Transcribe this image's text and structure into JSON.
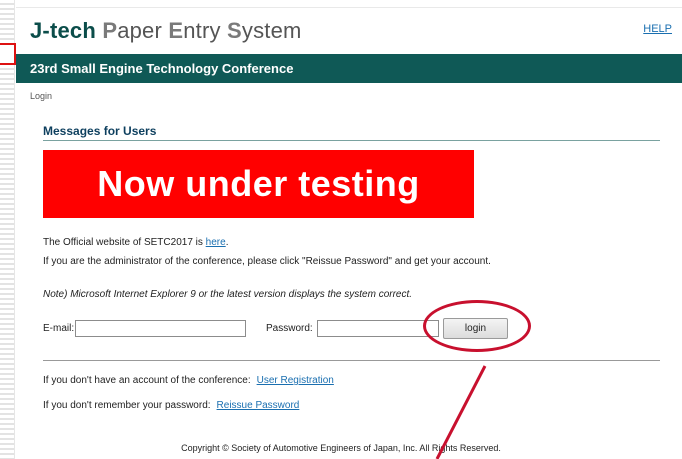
{
  "app": {
    "logo": {
      "part1": "J-tech",
      "p_cap": "P",
      "p_rest": "aper",
      "e_cap": "E",
      "e_rest": "ntry",
      "s_cap": "S",
      "s_rest": "ystem"
    },
    "help_label": "HELP"
  },
  "banner": {
    "title": "23rd Small Engine Technology Conference"
  },
  "breadcrumb": {
    "current": "Login"
  },
  "messages": {
    "heading": "Messages for Users",
    "testing_notice": "Now under testing",
    "official_prefix": "The Official website of SETC2017 is ",
    "official_link": "here",
    "official_suffix": ".",
    "admin_text": "If you are the administrator of the conference, please click \"Reissue Password\" and get your account.",
    "browser_note": "Note) Microsoft Internet Explorer 9 or the latest version displays the system correct."
  },
  "login_form": {
    "email_label": "E-mail:",
    "email_value": "",
    "password_label": "Password:",
    "password_value": "",
    "login_button": "login"
  },
  "account": {
    "no_account_text": "If you don't have an account of the conference:",
    "register_link": "User Registration",
    "forgot_text": "If you don't remember your password:",
    "reissue_link": "Reissue Password"
  },
  "footer": {
    "copyright": "Copyright © Society of Automotive Engineers of Japan, Inc. All Rights Reserved."
  },
  "colors": {
    "banner_bg": "#0f5956",
    "testing_bg": "#ff0000",
    "annotation_red": "#c8102e",
    "link_blue": "#1a6fb0"
  }
}
